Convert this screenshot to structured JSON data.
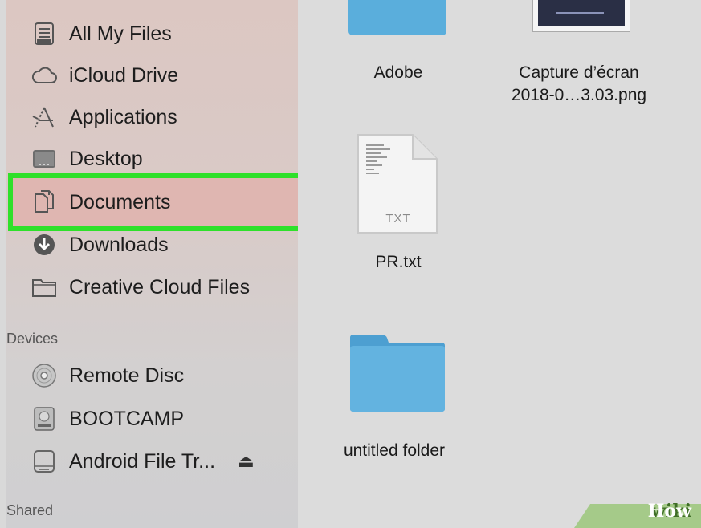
{
  "sidebar": {
    "favorites": [
      {
        "label": "All My Files",
        "icon": "all-my-files-icon"
      },
      {
        "label": "iCloud Drive",
        "icon": "cloud-icon"
      },
      {
        "label": "Applications",
        "icon": "applications-icon"
      },
      {
        "label": "Desktop",
        "icon": "desktop-icon"
      },
      {
        "label": "Documents",
        "icon": "documents-icon"
      },
      {
        "label": "Downloads",
        "icon": "download-icon"
      },
      {
        "label": "Creative Cloud Files",
        "icon": "folder-icon"
      }
    ],
    "devices_header": "Devices",
    "devices": [
      {
        "label": "Remote Disc",
        "icon": "disc-icon"
      },
      {
        "label": "BOOTCAMP",
        "icon": "drive-icon"
      },
      {
        "label": "Android File Tr...",
        "icon": "external-drive-icon",
        "eject": "⏏"
      }
    ],
    "shared_header": "Shared"
  },
  "files": [
    {
      "name": "Adobe",
      "type": "folder"
    },
    {
      "name_line1": "Capture d’écran",
      "name_line2": "2018-0…3.03.png",
      "type": "image"
    },
    {
      "name": "PR.txt",
      "type": "text",
      "badge": "TXT"
    },
    {
      "name": "untitled folder",
      "type": "folder"
    }
  ],
  "watermark": {
    "part1": "wiki",
    "part2": "How"
  },
  "colors": {
    "highlight_border": "#2fe02a",
    "folder_blue": "#5aaedc",
    "selection": "#dfb6b1"
  }
}
